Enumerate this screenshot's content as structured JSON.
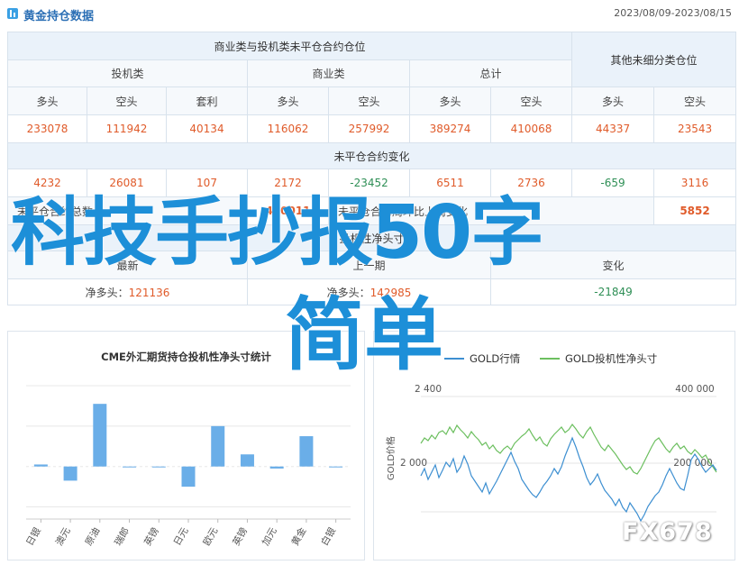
{
  "header": {
    "title": "黄金持仓数据",
    "date_range": "2023/08/09-2023/08/15"
  },
  "table": {
    "group_main": "商业类与投机类未平仓合约仓位",
    "group_other": "其他未细分类仓位",
    "sub_spec": "投机类",
    "sub_comm": "商业类",
    "sub_total": "总计",
    "col_long": "多头",
    "col_short": "空头",
    "col_spread": "套利",
    "row1": [
      "233078",
      "111942",
      "40134",
      "116062",
      "257992",
      "389274",
      "410068",
      "44337",
      "23543"
    ],
    "oi_change_label": "未平仓合约变化",
    "row2": [
      "4232",
      "26081",
      "107",
      "2172",
      "-23452",
      "6511",
      "2736",
      "-659",
      "3116"
    ],
    "oi_total_label": "未平仓合约总数",
    "oi_total_value": "480011",
    "oi_weekly_label": "未平仓合约周环比上周变化",
    "oi_weekly_value": "5852",
    "spec_net_label": "投机性净头寸",
    "latest_label": "最新",
    "prev_label": "上一期",
    "change_label": "变化",
    "net_prefix": "净多头：",
    "latest_net": "121136",
    "prev_net": "142985",
    "net_change": "-21849"
  },
  "overlay": {
    "line1": "科技手抄报50字",
    "line2": "简单",
    "watermark": "FX678"
  },
  "chart_data": [
    {
      "type": "bar",
      "title": "CME外汇期货持仓投机性净头寸统计",
      "categories": [
        "日银",
        "澳元",
        "原油",
        "瑞郎",
        "英镑",
        "日元",
        "欧元",
        "英镑",
        "加元",
        "黄金",
        "白银"
      ],
      "values": [
        1,
        -7,
        31,
        0,
        0,
        -10,
        20,
        6,
        -1,
        15,
        0
      ],
      "ylim": [
        -26,
        40
      ],
      "grid": true,
      "colors": {
        "bar": "#6aaee8"
      }
    },
    {
      "type": "line",
      "series": [
        {
          "name": "GOLD行情",
          "color": "#3d8fd1"
        },
        {
          "name": "GOLD投机性净头寸",
          "color": "#6cbf5f"
        }
      ],
      "left_axis_label": "GOLD价格",
      "left_ticks": [
        "2 400",
        "2 000"
      ],
      "right_ticks": [
        "400 000",
        "200 000"
      ],
      "grid": true
    }
  ]
}
